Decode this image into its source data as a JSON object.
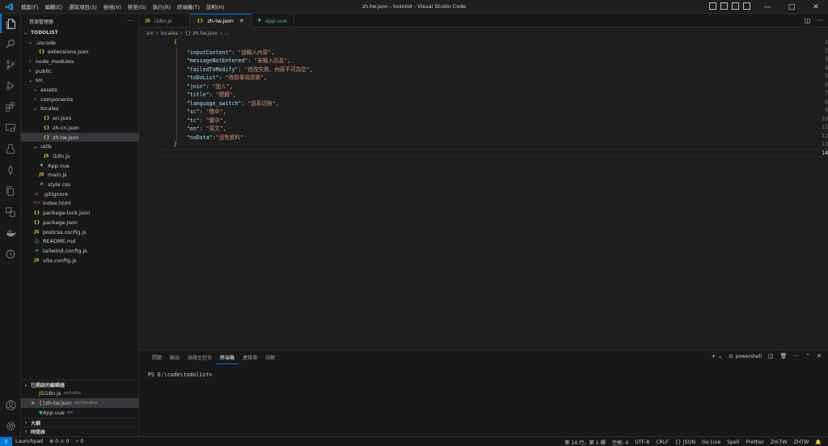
{
  "window": {
    "title": "zh-tw.json - todolist - Visual Studio Code",
    "menu": [
      "檔案(F)",
      "編輯(E)",
      "選取項目(S)",
      "檢視(V)",
      "移至(G)",
      "執行(R)",
      "終端機(T)",
      "說明(H)"
    ]
  },
  "sidebar": {
    "header": "資源管理器",
    "more": "···",
    "tree": [
      {
        "label": "TODOLIST",
        "depth": 0,
        "type": "root",
        "chev": "⌄"
      },
      {
        "label": ".vscode",
        "depth": 1,
        "type": "folder",
        "chev": "⌄"
      },
      {
        "label": "extensions.json",
        "depth": 2,
        "type": "json"
      },
      {
        "label": "node_modules",
        "depth": 1,
        "type": "folder",
        "chev": "›"
      },
      {
        "label": "public",
        "depth": 1,
        "type": "folder",
        "chev": "›"
      },
      {
        "label": "src",
        "depth": 1,
        "type": "folder",
        "chev": "⌄"
      },
      {
        "label": "assets",
        "depth": 2,
        "type": "folder",
        "chev": "›"
      },
      {
        "label": "components",
        "depth": 2,
        "type": "folder",
        "chev": "›"
      },
      {
        "label": "locales",
        "depth": 2,
        "type": "folder",
        "chev": "⌄"
      },
      {
        "label": "en.json",
        "depth": 3,
        "type": "json"
      },
      {
        "label": "zh-cn.json",
        "depth": 3,
        "type": "json"
      },
      {
        "label": "zh-tw.json",
        "depth": 3,
        "type": "json",
        "selected": true
      },
      {
        "label": "utils",
        "depth": 2,
        "type": "folder",
        "chev": "⌄"
      },
      {
        "label": "i18n.js",
        "depth": 3,
        "type": "js"
      },
      {
        "label": "App.vue",
        "depth": 2,
        "type": "vue"
      },
      {
        "label": "main.js",
        "depth": 2,
        "type": "js"
      },
      {
        "label": "style.css",
        "depth": 2,
        "type": "css"
      },
      {
        "label": ".gitignore",
        "depth": 1,
        "type": "git"
      },
      {
        "label": "index.html",
        "depth": 1,
        "type": "html"
      },
      {
        "label": "package-lock.json",
        "depth": 1,
        "type": "json"
      },
      {
        "label": "package.json",
        "depth": 1,
        "type": "json"
      },
      {
        "label": "postcss.config.js",
        "depth": 1,
        "type": "js"
      },
      {
        "label": "README.md",
        "depth": 1,
        "type": "md"
      },
      {
        "label": "tailwind.config.js",
        "depth": 1,
        "type": "tw"
      },
      {
        "label": "vite.config.js",
        "depth": 1,
        "type": "js"
      }
    ],
    "open_editors": {
      "header": "已開啟的編輯器",
      "items": [
        {
          "label": "i18n.js",
          "path": "src\\utils",
          "type": "js"
        },
        {
          "label": "zh-tw.json",
          "path": "src\\locales",
          "type": "json",
          "selected": true
        },
        {
          "label": "App.vue",
          "path": "src",
          "type": "vue"
        }
      ]
    },
    "outline": "大綱",
    "timeline": "時間表"
  },
  "tabs": [
    {
      "label": "i18n.js",
      "type": "js"
    },
    {
      "label": "zh-tw.json",
      "type": "json",
      "active": true
    },
    {
      "label": "App.vue",
      "type": "vue",
      "preview": true
    }
  ],
  "breadcrumb": [
    "src",
    "locales",
    "{} zh-tw.json",
    "..."
  ],
  "code": {
    "lines": [
      {
        "n": "1",
        "parts": [
          {
            "t": "{",
            "c": "brace"
          }
        ]
      },
      {
        "n": "2",
        "parts": [
          {
            "t": "    ",
            "c": "punc"
          },
          {
            "t": "\"inputContent\"",
            "c": "key"
          },
          {
            "t": ": ",
            "c": "punc"
          },
          {
            "t": "\"請輸入內容\"",
            "c": "str"
          },
          {
            "t": ",",
            "c": "punc"
          }
        ]
      },
      {
        "n": "3",
        "parts": [
          {
            "t": "    ",
            "c": "punc"
          },
          {
            "t": "\"messageNotEntered\"",
            "c": "key"
          },
          {
            "t": ": ",
            "c": "punc"
          },
          {
            "t": "\"未輸入訊息\"",
            "c": "str"
          },
          {
            "t": ",",
            "c": "punc"
          }
        ]
      },
      {
        "n": "4",
        "parts": [
          {
            "t": "    ",
            "c": "punc"
          },
          {
            "t": "\"failedToModify\"",
            "c": "key"
          },
          {
            "t": ": ",
            "c": "punc"
          },
          {
            "t": "\"修改失敗，內容不可為空\"",
            "c": "str"
          },
          {
            "t": ",",
            "c": "punc"
          }
        ]
      },
      {
        "n": "5",
        "parts": [
          {
            "t": "    ",
            "c": "punc"
          },
          {
            "t": "\"toDoList\"",
            "c": "key"
          },
          {
            "t": ": ",
            "c": "punc"
          },
          {
            "t": "\"待辦事項清單\"",
            "c": "str"
          },
          {
            "t": ",",
            "c": "punc"
          }
        ]
      },
      {
        "n": "6",
        "parts": [
          {
            "t": "    ",
            "c": "punc"
          },
          {
            "t": "\"join\"",
            "c": "key"
          },
          {
            "t": ": ",
            "c": "punc"
          },
          {
            "t": "\"加入\"",
            "c": "str"
          },
          {
            "t": ",",
            "c": "punc"
          }
        ]
      },
      {
        "n": "7",
        "parts": [
          {
            "t": "    ",
            "c": "punc"
          },
          {
            "t": "\"title\"",
            "c": "key"
          },
          {
            "t": ": ",
            "c": "punc"
          },
          {
            "t": "\"標題\"",
            "c": "str"
          },
          {
            "t": ",",
            "c": "punc"
          }
        ]
      },
      {
        "n": "8",
        "parts": [
          {
            "t": "    ",
            "c": "punc"
          },
          {
            "t": "\"language_switch\"",
            "c": "key"
          },
          {
            "t": ": ",
            "c": "punc"
          },
          {
            "t": "\"語系切換\"",
            "c": "str"
          },
          {
            "t": ",",
            "c": "punc"
          }
        ]
      },
      {
        "n": "9",
        "parts": [
          {
            "t": "    ",
            "c": "punc"
          },
          {
            "t": "\"sc\"",
            "c": "key"
          },
          {
            "t": ": ",
            "c": "punc"
          },
          {
            "t": "\"簡中\"",
            "c": "str"
          },
          {
            "t": ",",
            "c": "punc"
          }
        ]
      },
      {
        "n": "10",
        "parts": [
          {
            "t": "    ",
            "c": "punc"
          },
          {
            "t": "\"tc\"",
            "c": "key"
          },
          {
            "t": ": ",
            "c": "punc"
          },
          {
            "t": "\"繁中\"",
            "c": "str"
          },
          {
            "t": ",",
            "c": "punc"
          }
        ]
      },
      {
        "n": "11",
        "parts": [
          {
            "t": "    ",
            "c": "punc"
          },
          {
            "t": "\"en\"",
            "c": "key"
          },
          {
            "t": ": ",
            "c": "punc"
          },
          {
            "t": "\"英文\"",
            "c": "str"
          },
          {
            "t": ",",
            "c": "punc"
          }
        ]
      },
      {
        "n": "12",
        "parts": [
          {
            "t": "    ",
            "c": "punc"
          },
          {
            "t": "\"noData\"",
            "c": "key"
          },
          {
            "t": ":",
            "c": "punc"
          },
          {
            "t": "\"沒有資料\"",
            "c": "str"
          }
        ]
      },
      {
        "n": "13",
        "parts": [
          {
            "t": "}",
            "c": "brace"
          }
        ]
      },
      {
        "n": "14",
        "parts": []
      }
    ],
    "active_line": "14"
  },
  "panel": {
    "tabs": [
      "問題",
      "輸出",
      "偵錯主控台",
      "終端機",
      "連接埠",
      "註解"
    ],
    "active_tab": "終端機",
    "terminal_name": "powershell",
    "terminal_text": "PS E:\\code\\todolist>"
  },
  "statusbar": {
    "left": [
      "Launchpad",
      "⊗ 0 ⚠ 0",
      "⑂ 0"
    ],
    "right": [
      "第 14 行，第 1 欄",
      "空格: 4",
      "UTF-8",
      "CRLF",
      "{} JSON",
      "Go Live",
      "Spell",
      "Prettier",
      "ZH-TW",
      "ZHTW"
    ]
  },
  "colors": {
    "accent": "#0078d4",
    "json_key": "#9cdcfe",
    "json_string": "#ce9178",
    "bracket": "#ffd700"
  }
}
